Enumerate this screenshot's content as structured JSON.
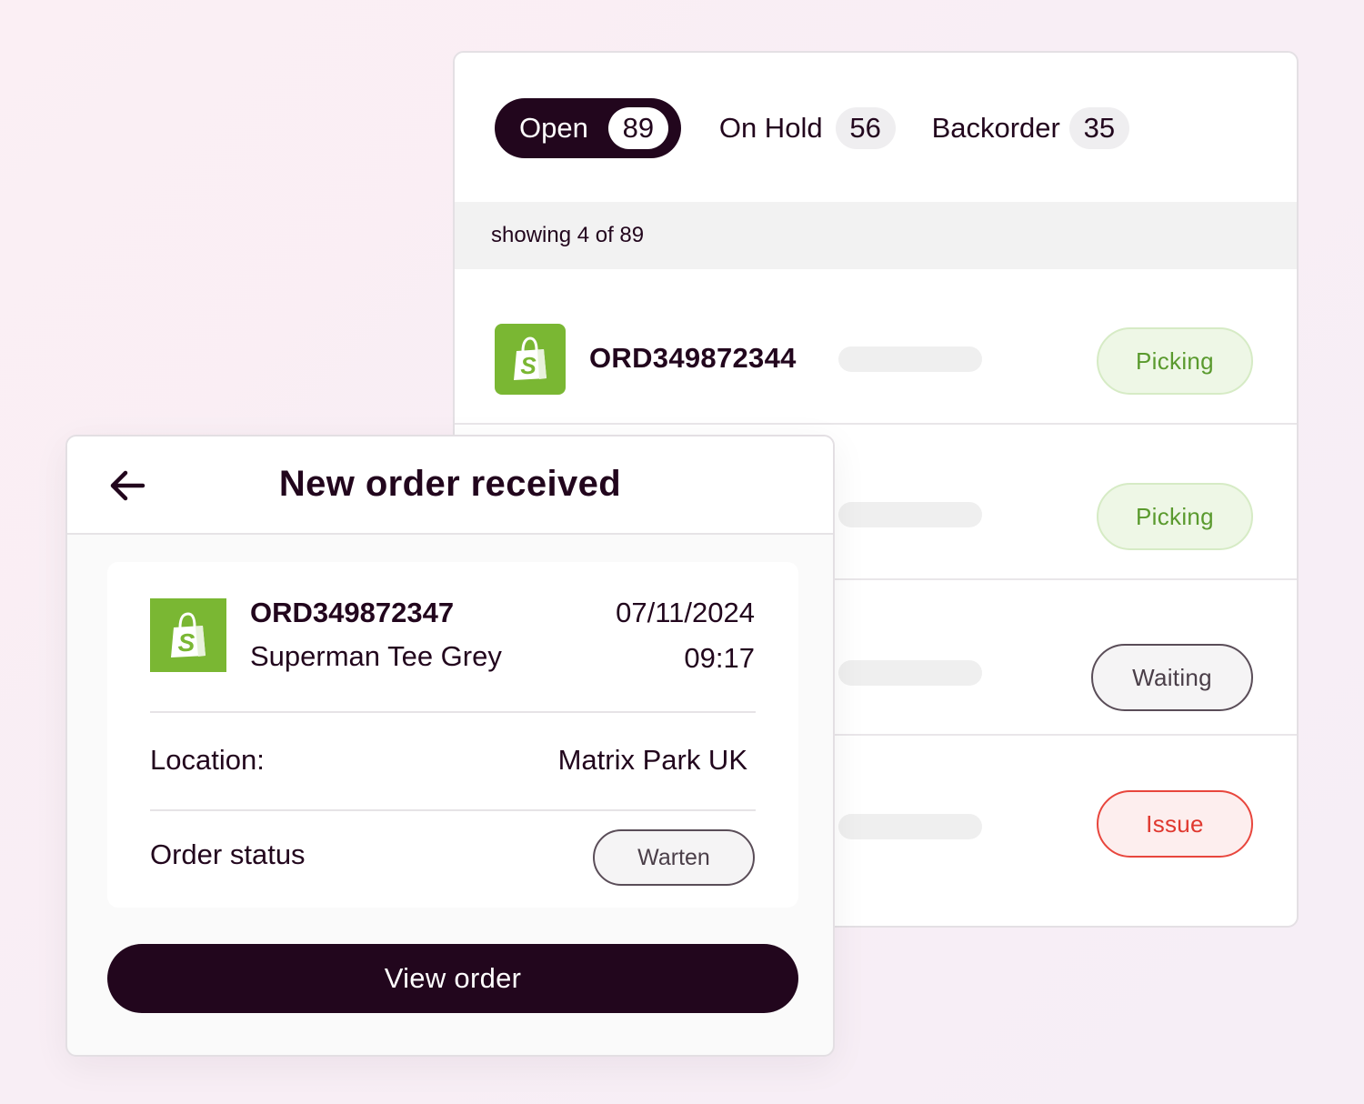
{
  "tabs": [
    {
      "label": "Open",
      "count": "89",
      "active": true
    },
    {
      "label": "On Hold",
      "count": "56",
      "active": false
    },
    {
      "label": "Backorder",
      "count": "35",
      "active": false
    }
  ],
  "list": {
    "showing_text": "showing 4 of 89",
    "rows": [
      {
        "order_id": "ORD349872344",
        "status": "Picking"
      },
      {
        "order_id": "",
        "status": "Picking"
      },
      {
        "order_id": "",
        "status": "Waiting"
      },
      {
        "order_id": "",
        "status": "Issue"
      }
    ]
  },
  "notification": {
    "title": "New order received",
    "order_id": "ORD349872347",
    "product": "Superman Tee Grey",
    "date": "07/11/2024",
    "time": "09:17",
    "location_label": "Location:",
    "location_value": "Matrix Park UK",
    "status_label": "Order status",
    "status_value": "Warten",
    "button_label": "View order"
  },
  "colors": {
    "brand_dark": "#22061d",
    "shopify_green": "#7ab733",
    "picking_text": "#5a9a2e",
    "issue_red": "#e0382f"
  },
  "icons": {
    "back": "arrow-left-icon",
    "shop": "shopify-bag-icon"
  }
}
